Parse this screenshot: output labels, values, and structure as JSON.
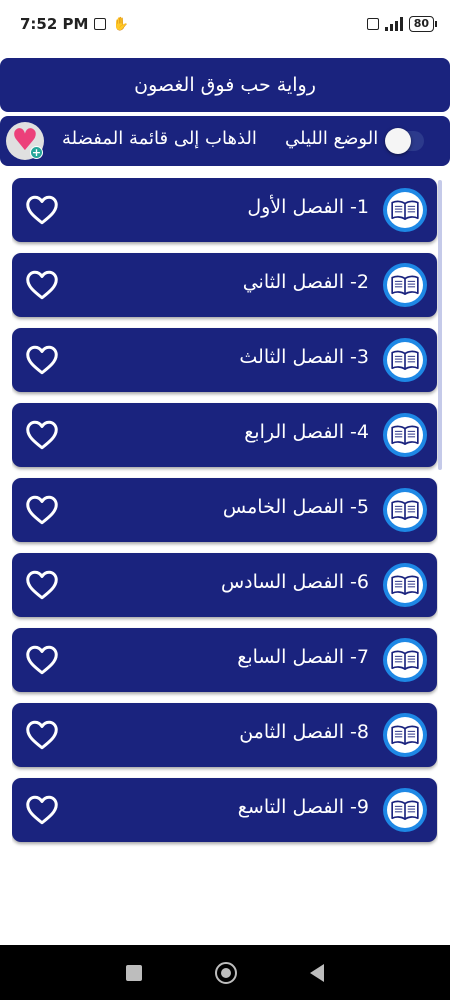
{
  "status": {
    "time": "7:52 PM",
    "battery": "80"
  },
  "header": {
    "title": "رواية حب فوق الغصون"
  },
  "controls": {
    "favorites_label": "الذهاب إلى قائمة المفضلة",
    "night_mode_label": "الوضع الليلي",
    "night_mode_on": false
  },
  "chapters": [
    {
      "label": "1- الفصل الأول"
    },
    {
      "label": "2- الفصل الثاني"
    },
    {
      "label": "3- الفصل الثالث"
    },
    {
      "label": "4- الفصل الرابع"
    },
    {
      "label": "5- الفصل الخامس"
    },
    {
      "label": "6- الفصل السادس"
    },
    {
      "label": "7- الفصل السابع"
    },
    {
      "label": "8- الفصل الثامن"
    },
    {
      "label": "9- الفصل التاسع"
    }
  ],
  "icons": {
    "favorite": "heart-outline-icon",
    "chapter": "open-book-icon",
    "favorites_list": "heart-plus-icon"
  },
  "colors": {
    "primary": "#1a237e",
    "accent": "#1e88e5",
    "favorite": "#ec407a"
  }
}
